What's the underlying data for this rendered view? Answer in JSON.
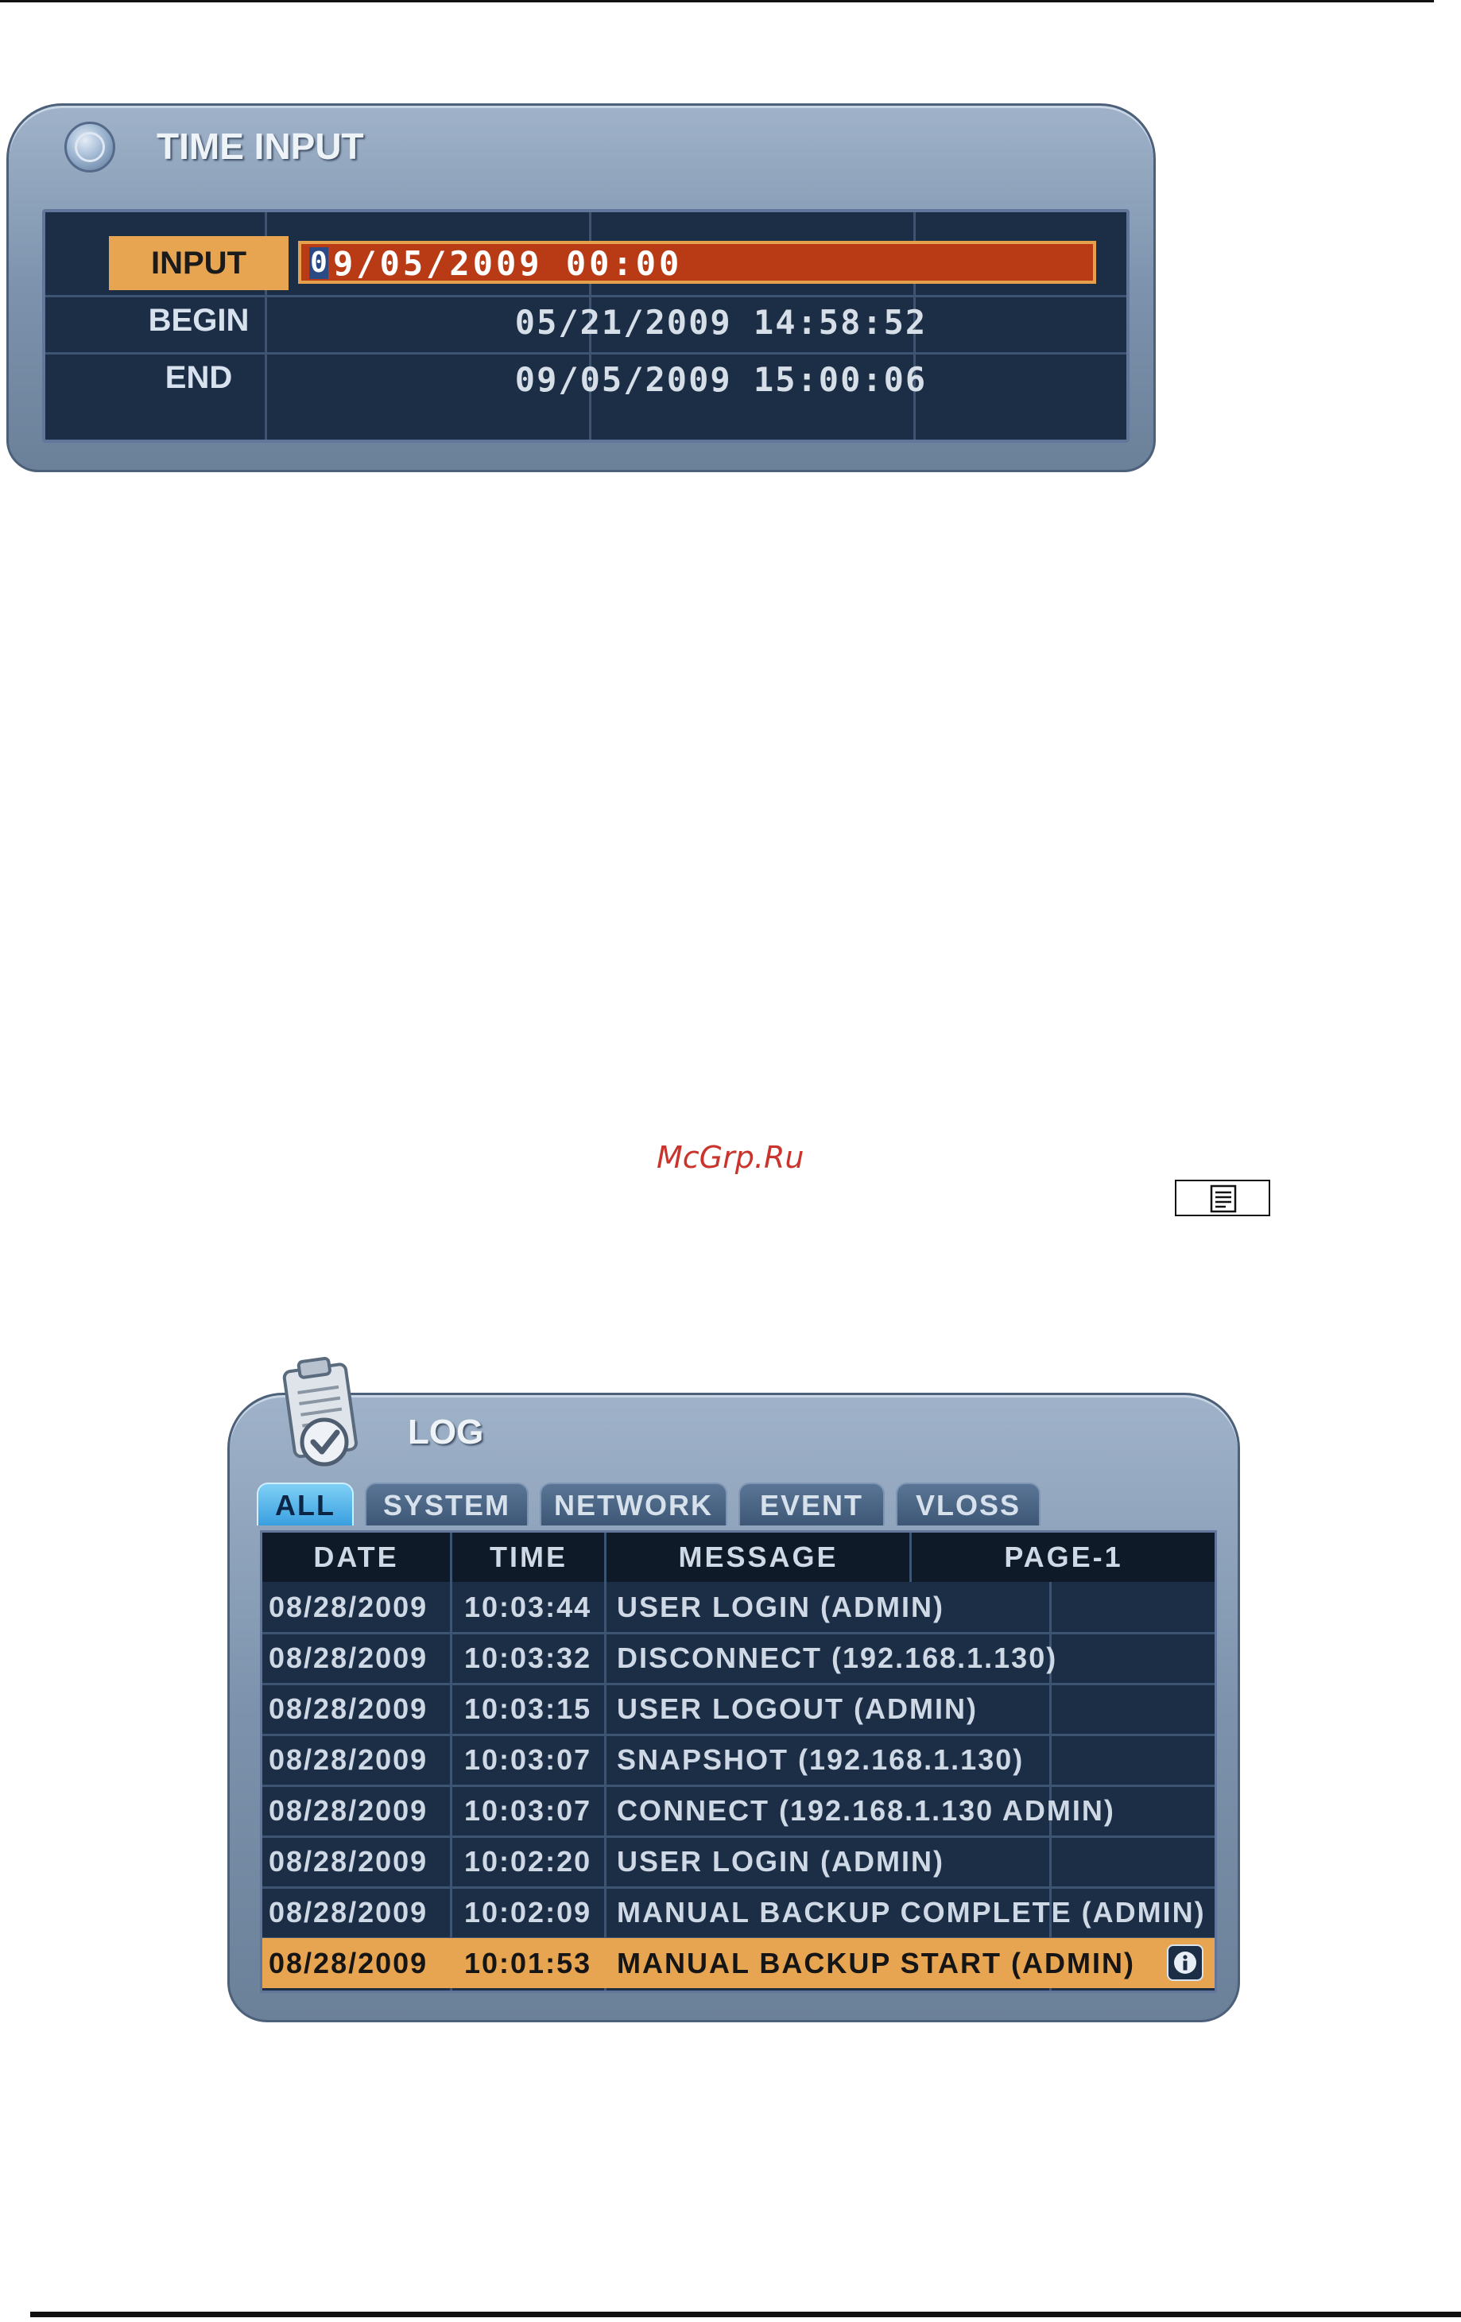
{
  "time_input": {
    "title": "TIME INPUT",
    "rows": [
      {
        "label": "INPUT",
        "value": "09/05/2009 00:00"
      },
      {
        "label": "BEGIN",
        "value": "05/21/2009 14:58:52"
      },
      {
        "label": "END",
        "value": "09/05/2009 15:00:06"
      }
    ],
    "cursor_char": "0",
    "input_rest": "9/05/2009 00:00"
  },
  "watermark": "McGrp.Ru",
  "log": {
    "title": "LOG",
    "tabs": [
      "ALL",
      "SYSTEM",
      "NETWORK",
      "EVENT",
      "VLOSS"
    ],
    "active_tab": "ALL",
    "columns": [
      "DATE",
      "TIME",
      "MESSAGE",
      "PAGE-1"
    ],
    "rows": [
      {
        "date": "08/28/2009",
        "time": "10:03:44",
        "message": "USER LOGIN (ADMIN)"
      },
      {
        "date": "08/28/2009",
        "time": "10:03:32",
        "message": "DISCONNECT (192.168.1.130)"
      },
      {
        "date": "08/28/2009",
        "time": "10:03:15",
        "message": "USER LOGOUT (ADMIN)"
      },
      {
        "date": "08/28/2009",
        "time": "10:03:07",
        "message": "SNAPSHOT (192.168.1.130)"
      },
      {
        "date": "08/28/2009",
        "time": "10:03:07",
        "message": "CONNECT (192.168.1.130 ADMIN)"
      },
      {
        "date": "08/28/2009",
        "time": "10:02:20",
        "message": "USER LOGIN (ADMIN)"
      },
      {
        "date": "08/28/2009",
        "time": "10:02:09",
        "message": "MANUAL BACKUP COMPLETE (ADMIN)"
      },
      {
        "date": "08/28/2009",
        "time": "10:01:53",
        "message": "MANUAL BACKUP START (ADMIN)"
      }
    ],
    "selected_row": 7
  },
  "colors": {
    "panel_body": "#1b2e46",
    "highlight": "#e7a552",
    "input_field": "#b93b16",
    "active_tab": "#3a9fe0",
    "watermark": "#c9352c"
  },
  "icons": [
    "orb-icon",
    "menu-key-icon",
    "clipboard-check-icon",
    "info-icon"
  ]
}
